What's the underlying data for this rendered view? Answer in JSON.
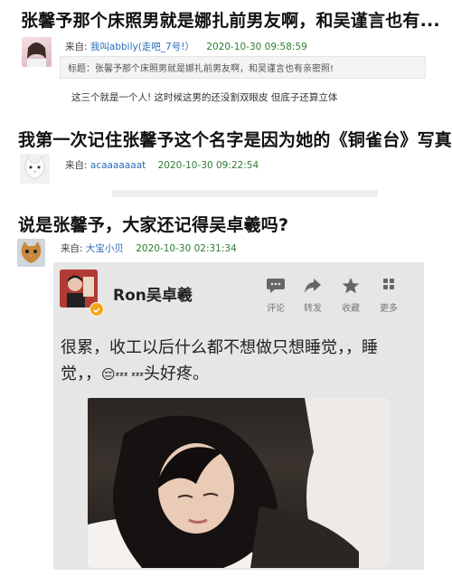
{
  "posts": [
    {
      "title": "张馨予那个床照男就是娜扎前男友啊，和吴谨言也有...",
      "prefix": "来自:",
      "user": "我叫abbily(走吧_7号!）",
      "time": "2020-10-30 09:58:59",
      "quote": "标题：张馨予那个床照男就是娜扎前男友啊，和吴谨言也有亲密照!",
      "body": "这三个就是一个人! 这时候这男的还没割双眼皮 但底子还算立体"
    },
    {
      "title": "我第一次记住张馨予这个名字是因为她的《铜雀台》写真",
      "prefix": "来自:",
      "user": "acaaaaaaat",
      "time": "2020-10-30 09:22:54"
    },
    {
      "title": "说是张馨予，大家还记得吴卓羲吗?",
      "prefix": "来自:",
      "user": "大宝小贝",
      "time": "2020-10-30 02:31:34"
    }
  ],
  "weibo": {
    "name": "Ron吴卓羲",
    "actions": [
      {
        "label": "评论",
        "icon": "comment-icon"
      },
      {
        "label": "转发",
        "icon": "repost-icon"
      },
      {
        "label": "收藏",
        "icon": "star-icon"
      },
      {
        "label": "更多",
        "icon": "more-icon"
      }
    ],
    "line1": "很累，收工以后什么都不想做只想睡觉，，睡",
    "line2_a": "觉，，",
    "zzz": "ᶻᶻᶻ ᶻᶻᶻ",
    "line2_b": "头好疼。"
  },
  "colors": {
    "link": "#2a6bb8",
    "time": "#2e7d32"
  }
}
